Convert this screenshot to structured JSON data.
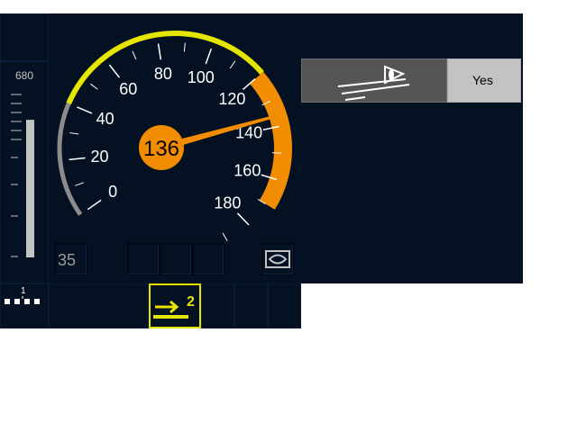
{
  "colors": {
    "background": "#031122",
    "page": "#ffffff",
    "yellow": "#e5e500",
    "orange": "#f28c00",
    "grey_arc": "#8c8c8c",
    "bar": "#c3c3c3",
    "text_white": "#ffffff",
    "ack_panel": "#c3c3c3",
    "ack_icon_panel": "#555555"
  },
  "distance": {
    "scale_top_label": "680",
    "bar_fill_fraction": 0.78
  },
  "speedometer": {
    "current_speed": "136",
    "current_speed_value": 136,
    "max_scale": 200,
    "ticks_labels": [
      "0",
      "20",
      "40",
      "60",
      "80",
      "100",
      "120",
      "140",
      "160",
      "180"
    ],
    "arc_grey_range": [
      0,
      40
    ],
    "arc_yellow_range": [
      40,
      120
    ],
    "arc_orange_range": [
      120,
      170
    ],
    "icon_right": "eye-icon"
  },
  "target_speed": "35",
  "acknowledge": {
    "icon": "track-ahead-icon",
    "label": "Yes"
  },
  "level": {
    "number": "1",
    "icon": "level-icon"
  },
  "mode": {
    "icon": "arrow-right-icon",
    "value": "2"
  }
}
